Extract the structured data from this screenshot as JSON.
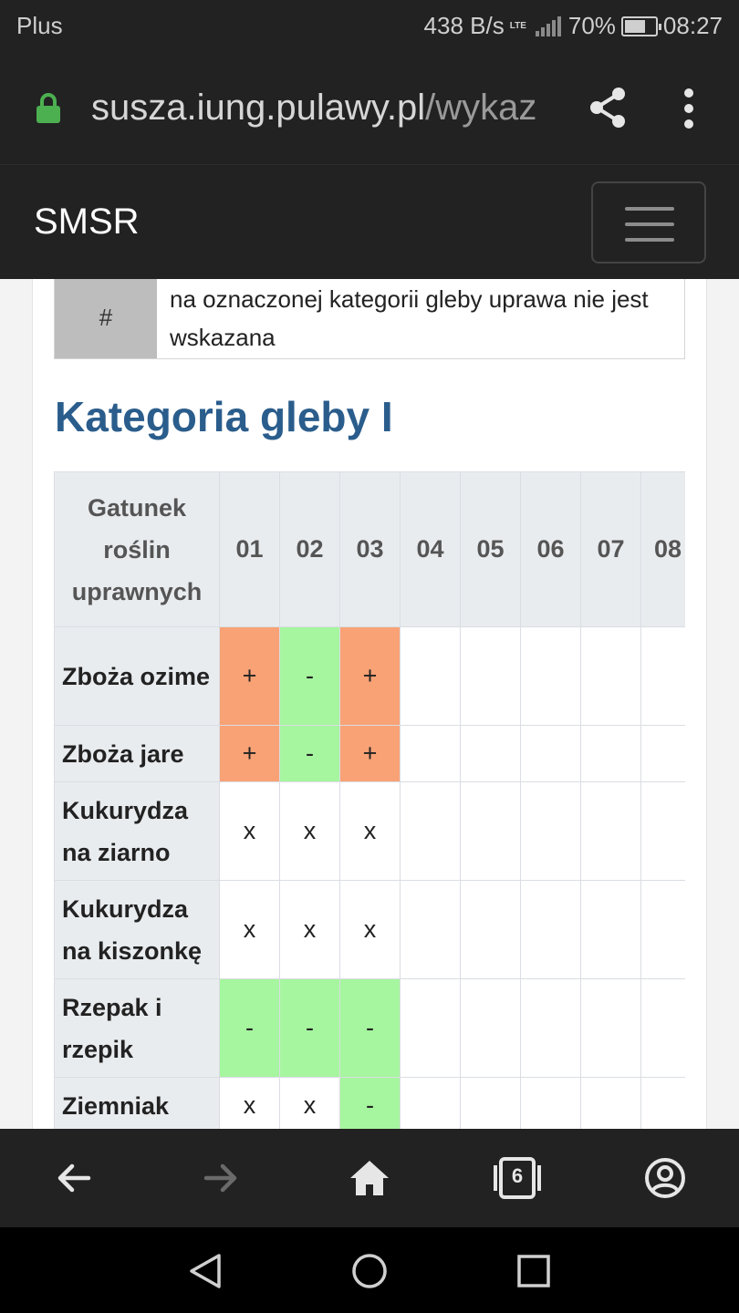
{
  "status_bar": {
    "carrier": "Plus",
    "speed": "438 B/s",
    "network": "LTE",
    "battery": "70%",
    "battery_level": 0.7,
    "time": "08:27"
  },
  "browser": {
    "url_host": "susza.iung.pulawy.pl",
    "url_path": "/wykaz",
    "tabs_count": "6"
  },
  "navbar": {
    "brand": "SMSR"
  },
  "legend": {
    "symbol": "#",
    "text": "na oznaczonej kategorii gleby uprawa nie jest wskazana"
  },
  "section_title": "Kategoria gleby I",
  "table": {
    "header_first": "Gatunek roślin uprawnych",
    "columns": [
      "01",
      "02",
      "03",
      "04",
      "05",
      "06",
      "07",
      "08"
    ],
    "rows": [
      {
        "name": "Zboża ozime",
        "cells": [
          "+",
          "-",
          "+",
          "",
          "",
          "",
          "",
          ""
        ]
      },
      {
        "name": "Zboża jare",
        "cells": [
          "+",
          "-",
          "+",
          "",
          "",
          "",
          "",
          ""
        ]
      },
      {
        "name": "Kukurydza na ziarno",
        "cells": [
          "x",
          "x",
          "x",
          "",
          "",
          "",
          "",
          ""
        ]
      },
      {
        "name": "Kukurydza na kiszonkę",
        "cells": [
          "x",
          "x",
          "x",
          "",
          "",
          "",
          "",
          ""
        ]
      },
      {
        "name": "Rzepak i rzepik",
        "cells": [
          "-",
          "-",
          "-",
          "",
          "",
          "",
          "",
          ""
        ]
      },
      {
        "name": "Ziemniak",
        "cells": [
          "x",
          "x",
          "-",
          "",
          "",
          "",
          "",
          ""
        ]
      }
    ]
  },
  "colors": {
    "plus": "#f8a276",
    "minus": "#a6f59f",
    "heading": "#2a5d8c",
    "lock": "#4caf50"
  },
  "icons": {
    "back": "arrow-left-icon",
    "forward": "arrow-right-icon",
    "home": "home-icon",
    "tabs": "tabs-icon",
    "account": "account-icon"
  }
}
